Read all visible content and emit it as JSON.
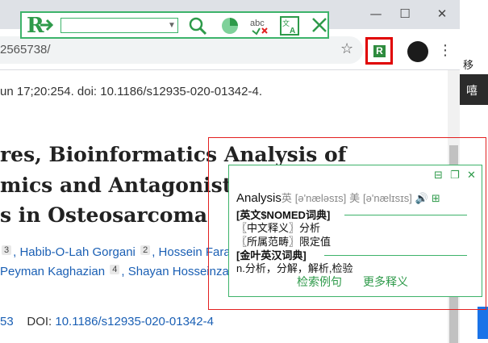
{
  "dictbar": {
    "search_value": "",
    "icons": [
      "logo-icon",
      "dropdown-icon",
      "search-icon",
      "pie-icon",
      "spellcheck-icon",
      "translate-icon",
      "close-icon"
    ]
  },
  "browser": {
    "url": "2565738/",
    "window_controls": {
      "minimize": "—",
      "maximize": "☐",
      "close": "✕"
    }
  },
  "page": {
    "citation": "un 17;20:254. doi: 10.1186/s12935-020-01342-4.",
    "title_lines": [
      "res, Bioinformatics Analysis of",
      "mics and Antagonists",
      "s in Osteosarcoma"
    ],
    "authors_line1": {
      "sup_a": "3",
      "name_a": "Habib-O-Lah Gorgani",
      "sup_b": "2",
      "name_b": "Hossein Faral"
    },
    "authors_line2": {
      "name_a": "Peyman Kaghazian",
      "sup_a": "4",
      "name_b": "Shayan Hosseinzad"
    },
    "doi_prefix": "53",
    "doi_label": "DOI:",
    "doi_value": "10.1186/s12935-020-01342-4"
  },
  "popup": {
    "headword": "Analysis",
    "uk_label": "英",
    "uk_phonetic": "[ə'næləsɪs]",
    "us_label": "美",
    "us_phonetic": "[ə'nælɪsɪs]",
    "section1": "[英文$NOMED词典]",
    "def1": "〖中文释义〗分析",
    "def2": "〖所属范畴〗限定值",
    "section2": "[金叶英汉词典]",
    "def3": "n.分析，分解，解析,检验",
    "link1": "检索例句",
    "link2": "更多释义"
  },
  "right_edge": {
    "text1": "移",
    "text2": "嘻"
  },
  "colors": {
    "accent": "#3db36a",
    "highlight": "#e32020",
    "link": "#1a5fb4"
  }
}
